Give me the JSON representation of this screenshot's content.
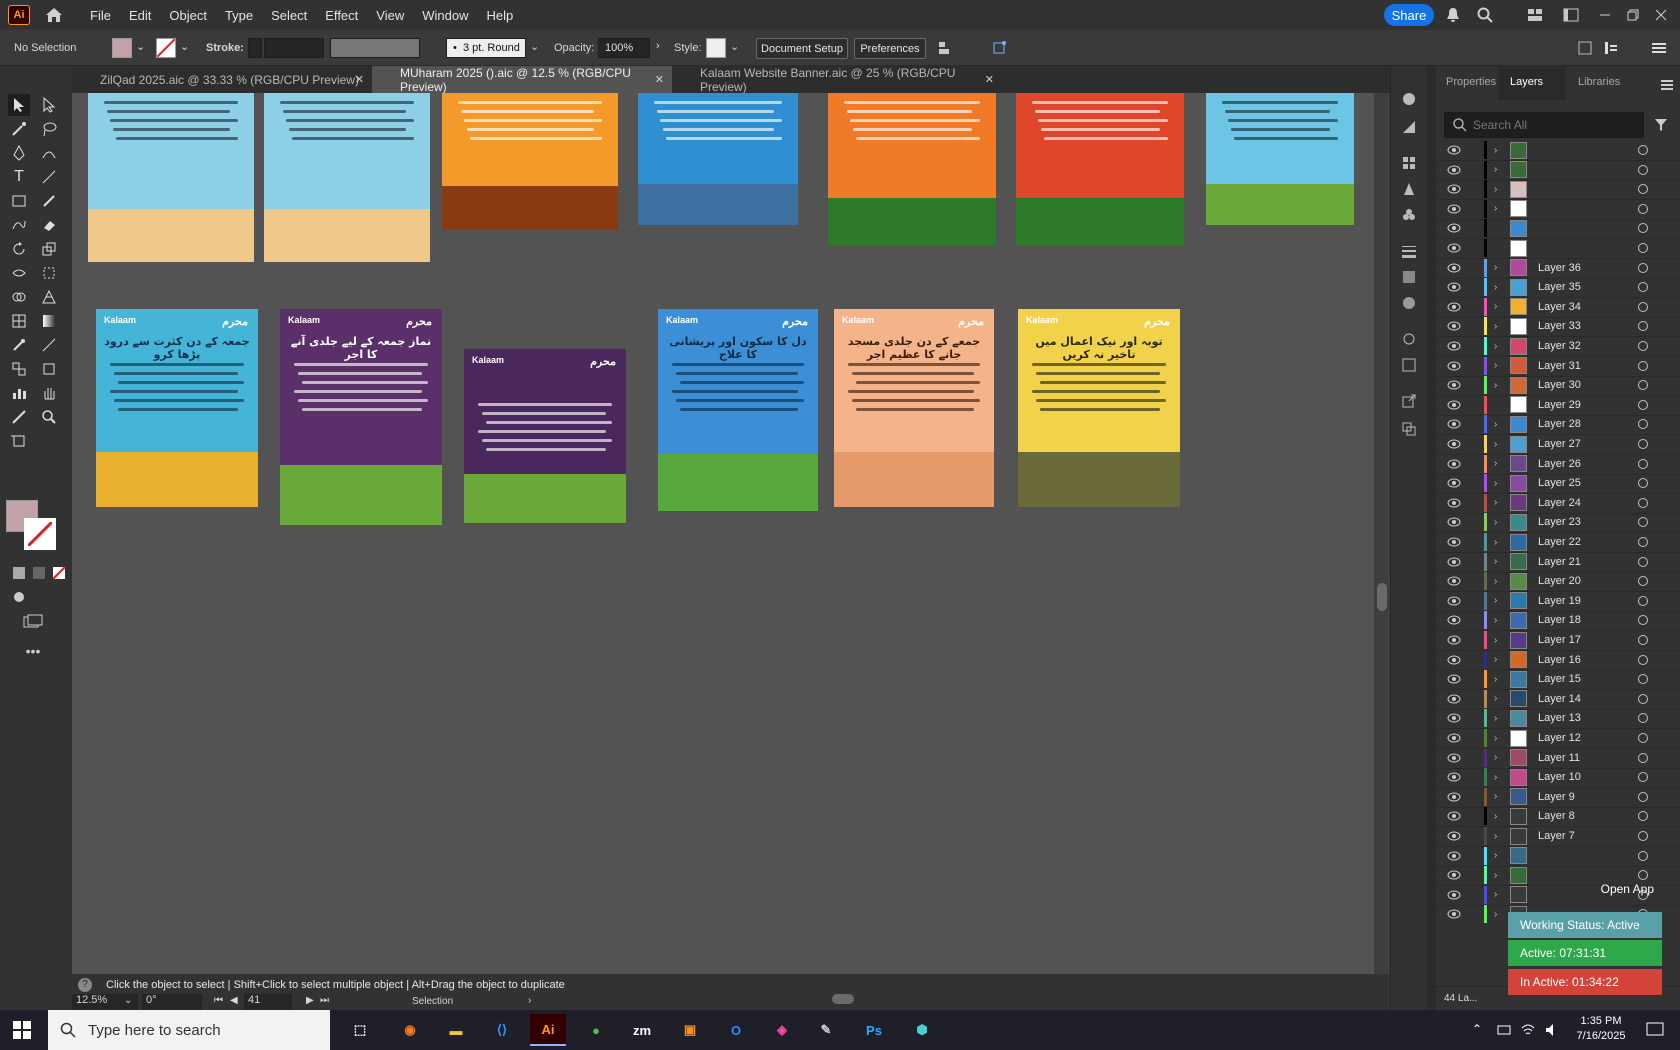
{
  "app": {
    "logo": "Ai",
    "menus": [
      "File",
      "Edit",
      "Object",
      "Type",
      "Select",
      "Effect",
      "View",
      "Window",
      "Help"
    ],
    "share_label": "Share"
  },
  "control": {
    "selection": "No Selection",
    "stroke_label": "Stroke:",
    "brush_value": "3 pt. Round",
    "opacity_label": "Opacity:",
    "opacity_value": "100%",
    "style_label": "Style:",
    "document_setup": "Document Setup",
    "preferences": "Preferences",
    "fill_color": "#c3a1a8"
  },
  "tabs": [
    {
      "label": "ZilQad 2025.aic @ 33.33 % (RGB/CPU Preview)",
      "active": false
    },
    {
      "label": "MUharam 2025 ().aic @ 12.5 % (RGB/CPU Preview)",
      "active": true
    },
    {
      "label": "Kalaam Website Banner.aic @ 25 % (RGB/CPU Preview)",
      "active": false
    }
  ],
  "artboards_top": [
    {
      "bg": "#8ecfe8",
      "ground": "#f0c98a",
      "text_color": "#1d2d3a"
    },
    {
      "bg": "#8ecfe8",
      "ground": "#f0c98a",
      "text_color": "#1d2d3a"
    },
    {
      "bg": "#f59a2a",
      "ground": "#8a3a10",
      "text_color": "#ffffff"
    },
    {
      "bg": "#2f8fd0",
      "ground": "#3d6fa0",
      "text_color": "#ffffff"
    },
    {
      "bg": "#f07a28",
      "ground": "#2c7a2a",
      "text_color": "#ffffff"
    },
    {
      "bg": "#e0462a",
      "ground": "#2c7a2a",
      "text_color": "#ffffff"
    },
    {
      "bg": "#6cc5e5",
      "ground": "#6aa83a",
      "text_color": "#1d2d3a"
    }
  ],
  "artboards_bottom": [
    {
      "brand": "Kalaam",
      "title": "جمعہ کے دن کثرت سے درود پڑھا کرو",
      "bg": "#44b5d6",
      "ground": "#e9b030",
      "text_color": "#12304a"
    },
    {
      "brand": "Kalaam",
      "title": "نماز جمعہ کے لیے جلدی آنے کا اجر",
      "bg": "#5b2f6a",
      "ground": "#6aa83a",
      "text_color": "#ffffff"
    },
    {
      "brand": "Kalaam",
      "title": "",
      "bg": "#4a275c",
      "ground": "#6aa83a",
      "text_color": "#ffffff"
    },
    {
      "brand": "Kalaam",
      "title": "دل کا سکون اور پریشانی کا علاج",
      "bg": "#3c8fd6",
      "ground": "#58a83e",
      "text_color": "#0e2a44"
    },
    {
      "brand": "Kalaam",
      "title": "جمعے کے دن جلدی مسجد جانے کا عظیم اجر",
      "bg": "#f5b38a",
      "ground": "#e49a6a",
      "text_color": "#3a1f10"
    },
    {
      "brand": "Kalaam",
      "title": "توبہ اور نیک اعمال میں تاخیر نہ کریں",
      "bg": "#f2d24a",
      "ground": "#6a6a3a",
      "text_color": "#2a2a10"
    }
  ],
  "panel": {
    "tabs": [
      "Properties",
      "Layers",
      "Libraries"
    ],
    "search_placeholder": "Search All",
    "layer_count": "44 La...",
    "layers": [
      {
        "name": "",
        "color": "#000000",
        "thumb": "#3a6a3a",
        "expand": true
      },
      {
        "name": "",
        "color": "#000000",
        "thumb": "#3a6a3a",
        "expand": true
      },
      {
        "name": "",
        "color": "#000000",
        "thumb": "#d8c0c0",
        "expand": true
      },
      {
        "name": "",
        "color": "#000000",
        "thumb": "#ffffff",
        "expand": true
      },
      {
        "name": "",
        "color": "#000000",
        "thumb": "#3a8ad0",
        "expand": false
      },
      {
        "name": "",
        "color": "#000000",
        "thumb": "#ffffff",
        "expand": false
      },
      {
        "name": "Layer 36",
        "color": "#5aa0ff",
        "thumb": "#b04a9a",
        "expand": true
      },
      {
        "name": "Layer 35",
        "color": "#49c9ff",
        "thumb": "#4aa0d0",
        "expand": true
      },
      {
        "name": "Layer 34",
        "color": "#ff4fb4",
        "thumb": "#f0b030",
        "expand": true
      },
      {
        "name": "Layer 33",
        "color": "#ffe14a",
        "thumb": "#ffffff",
        "expand": true
      },
      {
        "name": "Layer 32",
        "color": "#4affd0",
        "thumb": "#d04a6a",
        "expand": true
      },
      {
        "name": "Layer 31",
        "color": "#8a4aff",
        "thumb": "#d05a3a",
        "expand": true
      },
      {
        "name": "Layer 30",
        "color": "#4aff5a",
        "thumb": "#d06a3a",
        "expand": true
      },
      {
        "name": "Layer 29",
        "color": "#ff4a4a",
        "thumb": "#ffffff",
        "expand": false
      },
      {
        "name": "Layer 28",
        "color": "#4a6aff",
        "thumb": "#3a8ad0",
        "expand": true
      },
      {
        "name": "Layer 27",
        "color": "#ffd04a",
        "thumb": "#4aa0d0",
        "expand": true
      },
      {
        "name": "Layer 26",
        "color": "#ff8a4a",
        "thumb": "#6a4a8a",
        "expand": true
      },
      {
        "name": "Layer 25",
        "color": "#b04aff",
        "thumb": "#8a4aa0",
        "expand": true
      },
      {
        "name": "Layer 24",
        "color": "#c04a4a",
        "thumb": "#6a3a7a",
        "expand": true
      },
      {
        "name": "Layer 23",
        "color": "#8ad04a",
        "thumb": "#3a8a8a",
        "expand": true
      },
      {
        "name": "Layer 22",
        "color": "#4a9aa0",
        "thumb": "#2a6aa0",
        "expand": true
      },
      {
        "name": "Layer 21",
        "color": "#6a8a8a",
        "thumb": "#3a6a4a",
        "expand": true
      },
      {
        "name": "Layer 20",
        "color": "#6a6a4a",
        "thumb": "#5a8a4a",
        "expand": true
      },
      {
        "name": "Layer 19",
        "color": "#4a7aa0",
        "thumb": "#2a7ab0",
        "expand": true
      },
      {
        "name": "Layer 18",
        "color": "#8a8aff",
        "thumb": "#3a6ab0",
        "expand": true
      },
      {
        "name": "Layer 17",
        "color": "#ff4a8a",
        "thumb": "#5a3a8a",
        "expand": true
      },
      {
        "name": "Layer 16",
        "color": "#2a2aa0",
        "thumb": "#d06a2a",
        "expand": true
      },
      {
        "name": "Layer 15",
        "color": "#ff9a2a",
        "thumb": "#3a7aa0",
        "expand": true
      },
      {
        "name": "Layer 14",
        "color": "#c08a4a",
        "thumb": "#2a4a6a",
        "expand": true
      },
      {
        "name": "Layer 13",
        "color": "#4ac08a",
        "thumb": "#4a8aa0",
        "expand": true
      },
      {
        "name": "Layer 12",
        "color": "#4a8a2a",
        "thumb": "#ffffff",
        "expand": true
      },
      {
        "name": "Layer 11",
        "color": "#5a2a8a",
        "thumb": "#a04a6a",
        "expand": true
      },
      {
        "name": "Layer 10",
        "color": "#2a8a4a",
        "thumb": "#c04a8a",
        "expand": true
      },
      {
        "name": "Layer 9",
        "color": "#8a5a2a",
        "thumb": "#3a5a8a",
        "expand": true
      },
      {
        "name": "Layer 8",
        "color": "#000000",
        "thumb": "#3a3a3a",
        "expand": true
      },
      {
        "name": "Layer 7",
        "color": "#4a4a4a",
        "thumb": "#3a3a3a",
        "expand": true
      },
      {
        "name": "",
        "color": "#4ae0ff",
        "thumb": "#3a6a8a",
        "expand": true
      },
      {
        "name": "",
        "color": "#4affa0",
        "thumb": "#3a6a3a",
        "expand": true
      },
      {
        "name": "",
        "color": "#4a4aff",
        "thumb": "#3a3a3a",
        "expand": true
      },
      {
        "name": "",
        "color": "#4aff4a",
        "thumb": "#3a3a3a",
        "expand": true
      }
    ]
  },
  "status": {
    "tip": "Click the object to select  |  Shift+Click to select multiple object  |  Alt+Drag the object to duplicate",
    "zoom": "12.5%",
    "rotation": "0°",
    "artboard": "41",
    "mode": "Selection"
  },
  "widget": {
    "open_app": "Open App",
    "working": "Working Status: Active",
    "active": "Active: 07:31:31",
    "inactive": "In Active: 01:34:22"
  },
  "taskbar": {
    "search_placeholder": "Type here to search",
    "time": "1:35 PM",
    "date": "7/16/2025",
    "apps": [
      {
        "label": "⬚",
        "color": "#ffffff"
      },
      {
        "label": "◉",
        "color": "#ff7a1a"
      },
      {
        "label": "▬",
        "color": "#f0c040"
      },
      {
        "label": "⟨⟩",
        "color": "#2a9aff"
      },
      {
        "label": "Ai",
        "color": "#ff9a00"
      },
      {
        "label": "●",
        "color": "#4ac04a"
      },
      {
        "label": "zm",
        "color": "#ffffff"
      },
      {
        "label": "▣",
        "color": "#ff8a1a"
      },
      {
        "label": "O",
        "color": "#2a8aff"
      },
      {
        "label": "◈",
        "color": "#ff4ab0"
      },
      {
        "label": "✎",
        "color": "#cccccc"
      },
      {
        "label": "Ps",
        "color": "#31a8ff"
      },
      {
        "label": "⬢",
        "color": "#4ad0d0"
      }
    ]
  }
}
